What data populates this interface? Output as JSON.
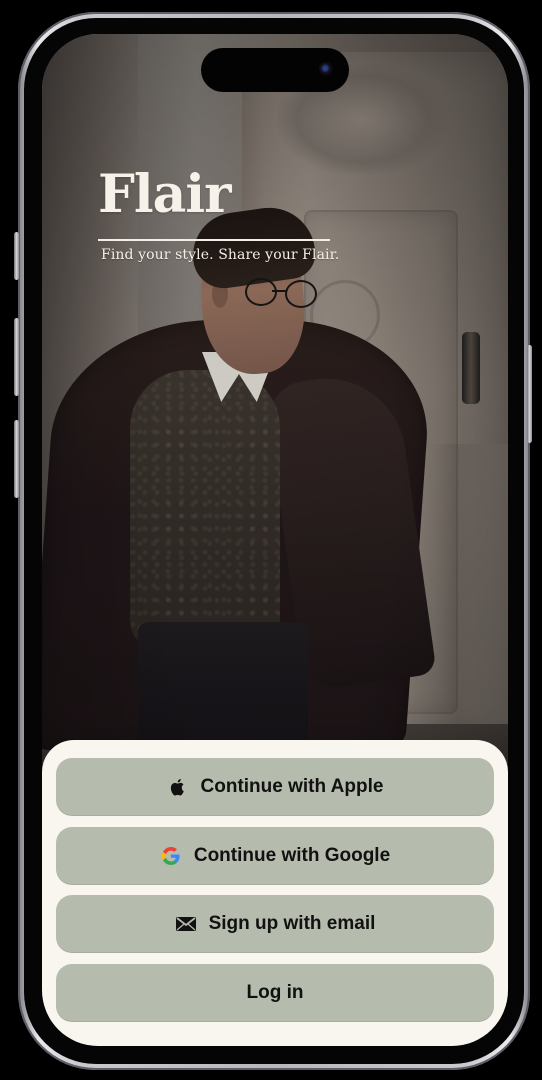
{
  "app": {
    "title": "Flair",
    "tagline": "Find your style. Share your Flair."
  },
  "auth": {
    "apple_label": "Continue with Apple",
    "google_label": "Continue with Google",
    "email_label": "Sign up with email",
    "login_label": "Log in"
  },
  "icons": {
    "apple": "apple-icon",
    "google": "google-icon",
    "email": "mail-icon"
  },
  "colors": {
    "title_text": "#f7f2e9",
    "sheet_background": "#f8f6ef",
    "button_background": "#b6bcad",
    "button_text": "#111111"
  }
}
